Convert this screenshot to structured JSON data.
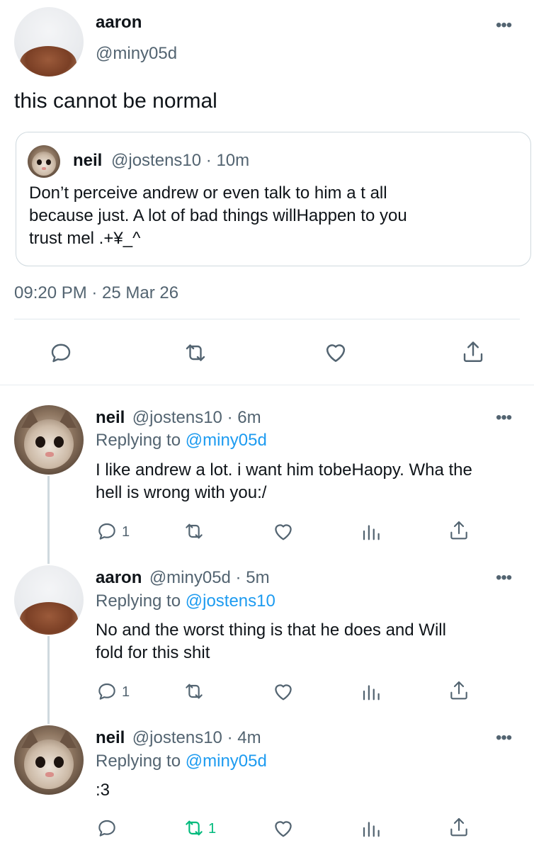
{
  "main_tweet": {
    "name": "aaron",
    "handle": "@miny05d",
    "text": "this cannot be normal",
    "quoted": {
      "name": "neil",
      "meta": "@jostens10 · 10m",
      "text_line1": "Don’t perceive andrew or even talk to him a t all",
      "text_line2": "because just. A lot of bad things willHappen to you",
      "text_line3": "trust mel .+¥_^"
    },
    "timestamp": "09:20 PM · 25 Mar 26",
    "more_icon": "more-horizontal-icon",
    "actions": [
      "reply-icon",
      "retweet-icon",
      "like-icon",
      "share-icon"
    ]
  },
  "replies": [
    {
      "name": "neil",
      "meta": "@jostens10 · 6m",
      "replying_prefix": "Replying to",
      "replying_to": "@miny05d",
      "text_line1": "I like andrew a lot. i want him tobeHaopy. Wha the",
      "text_line2": "hell is wrong with you:/",
      "reply_count": "1",
      "retweet_count": "",
      "icons": [
        "reply-icon",
        "retweet-icon",
        "like-icon",
        "analytics-icon",
        "share-icon"
      ]
    },
    {
      "name": "aaron",
      "meta": "@miny05d · 5m",
      "replying_prefix": "Replying to",
      "replying_to": "@jostens10",
      "text_line1": "No and the worst thing is that he does and Will",
      "text_line2": "fold for this shit",
      "reply_count": "1",
      "retweet_count": ""
    },
    {
      "name": "neil",
      "meta": "@jostens10 · 4m",
      "replying_prefix": "Replying to",
      "replying_to": "@miny05d",
      "text_line1": ":3",
      "reply_count": "",
      "retweet_count": "1"
    }
  ],
  "colors": {
    "text": "#0f1419",
    "secondary": "#536471",
    "link": "#1d9bf0",
    "retweeted": "#00ba7c",
    "border": "#cfd9de"
  }
}
